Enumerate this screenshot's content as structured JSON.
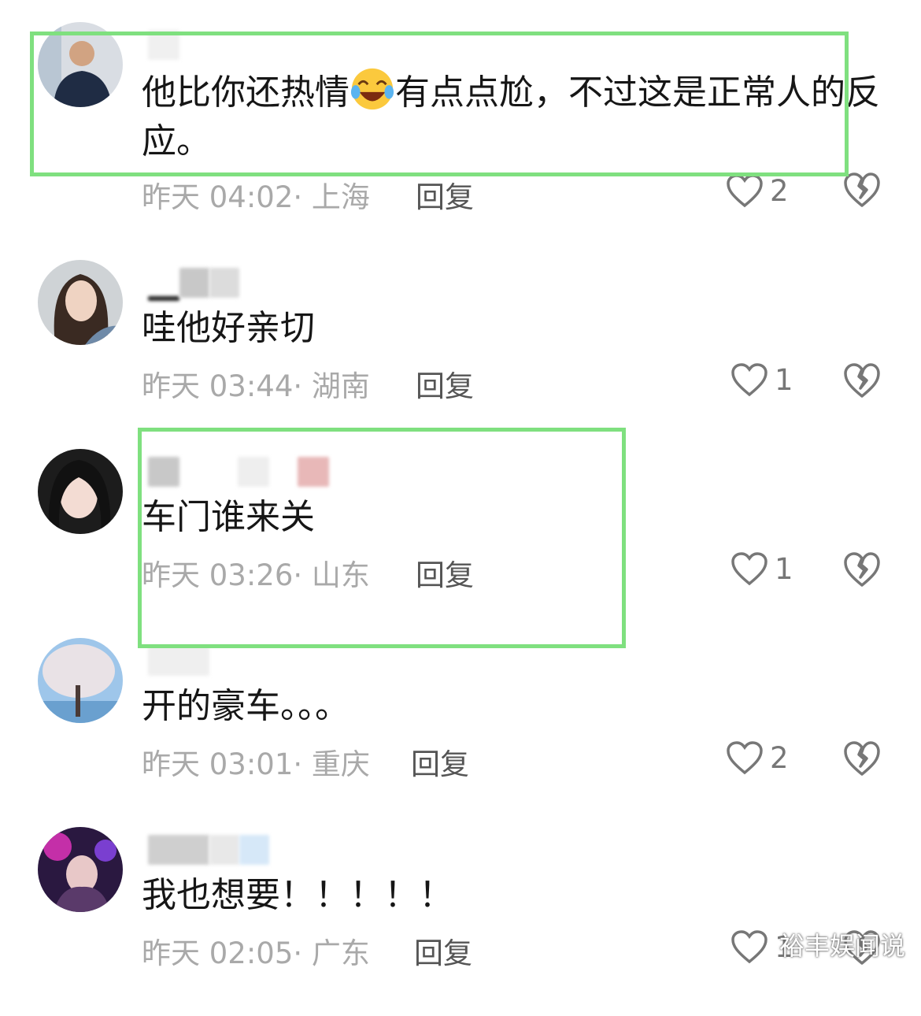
{
  "reply_label": "回复",
  "highlight_color": "#7fe07f",
  "comments": [
    {
      "content_a": "他比你还热情",
      "emoji": "laughing-tears-emoji",
      "content_b": "有点点尬，不过这是正常人的反应。",
      "meta": "昨天 04:02· 上海",
      "likes": "2"
    },
    {
      "content": "哇他好亲切",
      "meta": "昨天 03:44· 湖南",
      "likes": "1"
    },
    {
      "content": "车门谁来关",
      "meta": "昨天 03:26· 山东",
      "likes": "1"
    },
    {
      "content": "开的豪车。。。",
      "meta": "昨天 03:01· 重庆",
      "likes": "2"
    },
    {
      "content": "我也想要！！！！！",
      "meta": "昨天 02:05· 广东",
      "likes": "1"
    }
  ],
  "watermark": "裕丰娱闻说"
}
